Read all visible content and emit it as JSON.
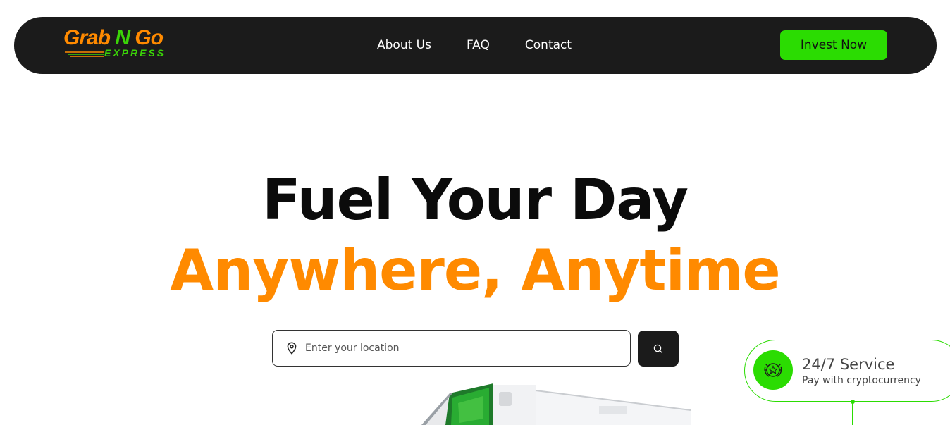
{
  "header": {
    "logo": {
      "word1": "Grab",
      "word2": "N",
      "word3": "Go",
      "tagline": "EXPRESS"
    },
    "nav": [
      {
        "label": "About Us"
      },
      {
        "label": "FAQ"
      },
      {
        "label": "Contact"
      }
    ],
    "cta_label": "Invest Now"
  },
  "hero": {
    "line1": "Fuel Your Day",
    "line2": "Anywhere, Anytime",
    "search": {
      "placeholder": "Enter your location",
      "icon": "map-pin-icon",
      "button_icon": "search-icon"
    }
  },
  "badge": {
    "title": "24/7 Service",
    "subtitle": "Pay with cryptocurrency",
    "icon": "award-star-icon"
  },
  "colors": {
    "accent_green": "#2bdc02",
    "accent_orange": "#ff8a00",
    "dark": "#1b1b1b"
  }
}
